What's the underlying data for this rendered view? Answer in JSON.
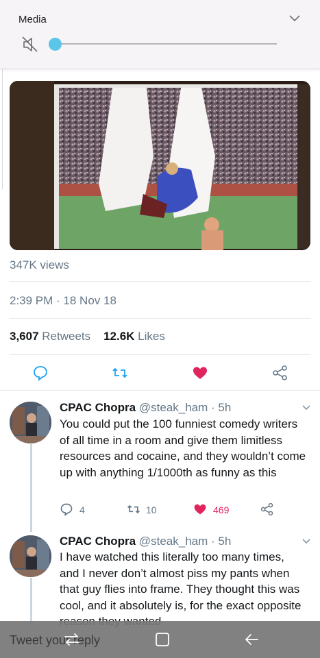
{
  "media_panel": {
    "label": "Media",
    "volume_level": 0.0,
    "muted": true
  },
  "main_tweet": {
    "views": "347K views",
    "timestamp": "2:39 PM · 18 Nov 18",
    "retweets_count": "3,607",
    "retweets_label": "Retweets",
    "likes_count": "12.6K",
    "likes_label": "Likes",
    "liked": true
  },
  "colors": {
    "like_active": "#e0245e",
    "secondary_text": "#657786",
    "slider_thumb": "#5cc6e8"
  },
  "replies": [
    {
      "name": "CPAC Chopra",
      "handle": "@steak_ham · 5h",
      "text": "You could put the 100 funniest comedy writers of all time in a room and give them limitless resources and cocaine, and they wouldn’t come up with anything 1/1000th as funny as this",
      "reply_count": "4",
      "retweet_count": "10",
      "like_count": "469"
    },
    {
      "name": "CPAC Chopra",
      "handle": "@steak_ham · 5h",
      "text": "I have watched this literally too many times, and I never don’t almost piss my pants when that guy flies into frame. They thought this was cool, and it absolutely is, for the exact opposite reason they wanted"
    }
  ],
  "compose": {
    "placeholder": "Tweet your reply"
  },
  "icons": {
    "reply": "reply-icon",
    "retweet": "retweet-icon",
    "like": "heart-icon",
    "share": "share-icon",
    "mute": "mute-icon",
    "collapse": "chevron-down-icon",
    "nav_recents": "recents-icon",
    "nav_home": "home-icon",
    "nav_back": "back-icon"
  }
}
